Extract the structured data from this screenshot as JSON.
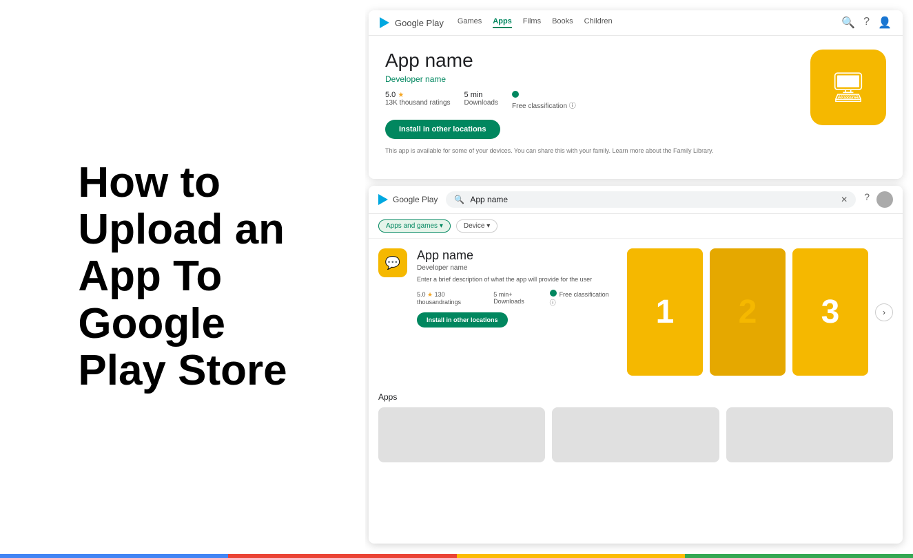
{
  "left": {
    "title_line1": "How to",
    "title_line2": "Upload an",
    "title_line3": "App To",
    "title_line4": "Google",
    "title_line5": "Play Store"
  },
  "top_screenshot": {
    "logo": "Google Play",
    "nav_items": [
      "Games",
      "Apps",
      "Films",
      "Books",
      "Children"
    ],
    "active_nav": "Apps",
    "app_name": "App name",
    "developer": "Developer name",
    "rating": "5.0 ★",
    "rating_sub": "13K thousand ratings",
    "downloads": "5 min",
    "downloads_sub": "Downloads",
    "free_label": "Free classification",
    "install_btn": "Install in other locations",
    "family_note": "This app is available for some of your devices.   You can share this with your family. Learn more about the Family Library.",
    "search_icon": "🔍",
    "help_icon": "?",
    "account_icon": "👤"
  },
  "bottom_screenshot": {
    "logo": "Google Play",
    "search_placeholder": "App name",
    "filter_chips": [
      "Apps and games ▾",
      "Device ▾"
    ],
    "app_name": "App name",
    "developer": "Developer name",
    "description": "Enter a brief description of what the app will provide for the user",
    "rating": "5.0 ★",
    "rating_sub": "130 thousandratings",
    "downloads": "5 min+",
    "downloads_sub": "Downloads",
    "free_label": "Free classification",
    "install_btn": "Install in other locations",
    "screenshot_numbers": [
      "1",
      "2",
      "3"
    ],
    "apps_label": "Apps",
    "help_icon": "?",
    "search_icon": "🔍"
  },
  "bottom_bar": {
    "colors": [
      "blue",
      "red",
      "yellow",
      "green"
    ]
  }
}
